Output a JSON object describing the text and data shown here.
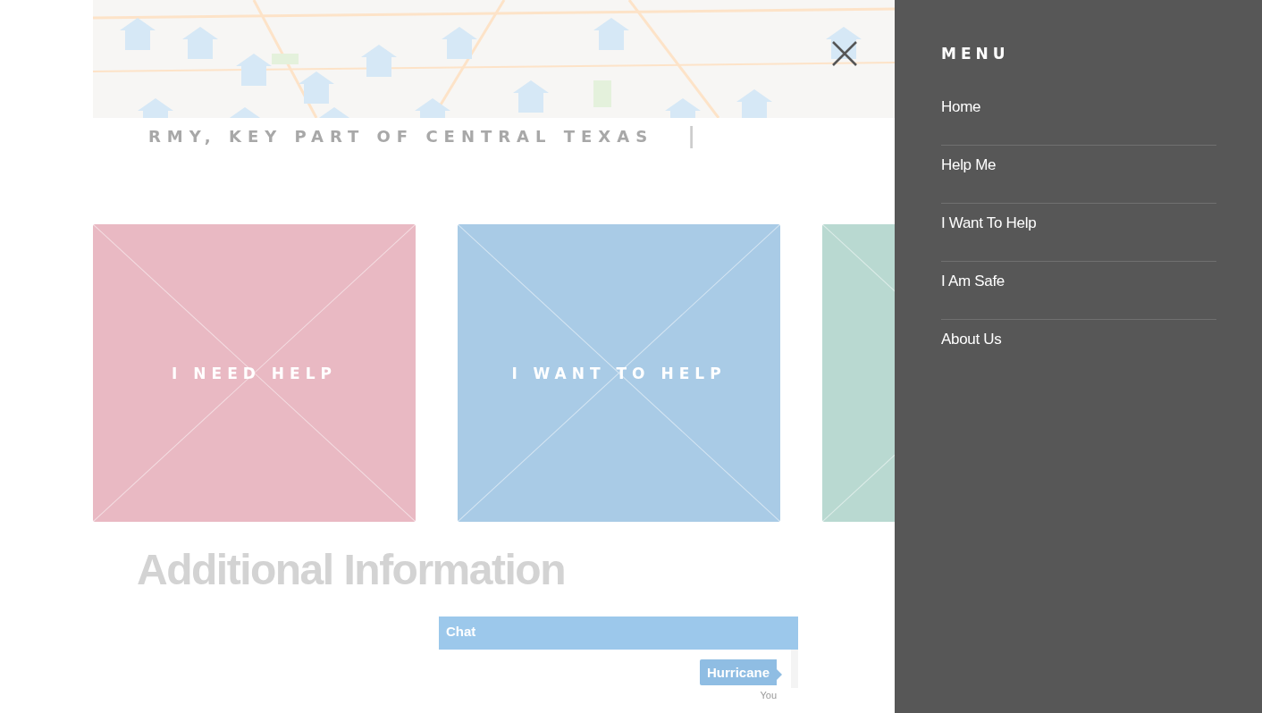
{
  "page": {
    "tagline": "RMY, KEY PART OF CENTRAL TEXAS",
    "cursor": "|",
    "cards": [
      {
        "label": "I NEED HELP",
        "color": "#e9b9c3"
      },
      {
        "label": "I WANT TO HELP",
        "color": "#a9cbe6"
      },
      {
        "color": "#b9d9d1"
      }
    ],
    "heading": "Additional Information",
    "chat": {
      "title": "Chat",
      "messages": [
        {
          "text": "Hurricane",
          "sender": "You"
        }
      ]
    }
  },
  "menu": {
    "title": "MENU",
    "items": [
      "Home",
      "Help Me",
      "I Want To Help",
      "I Am Safe",
      "About Us"
    ]
  }
}
